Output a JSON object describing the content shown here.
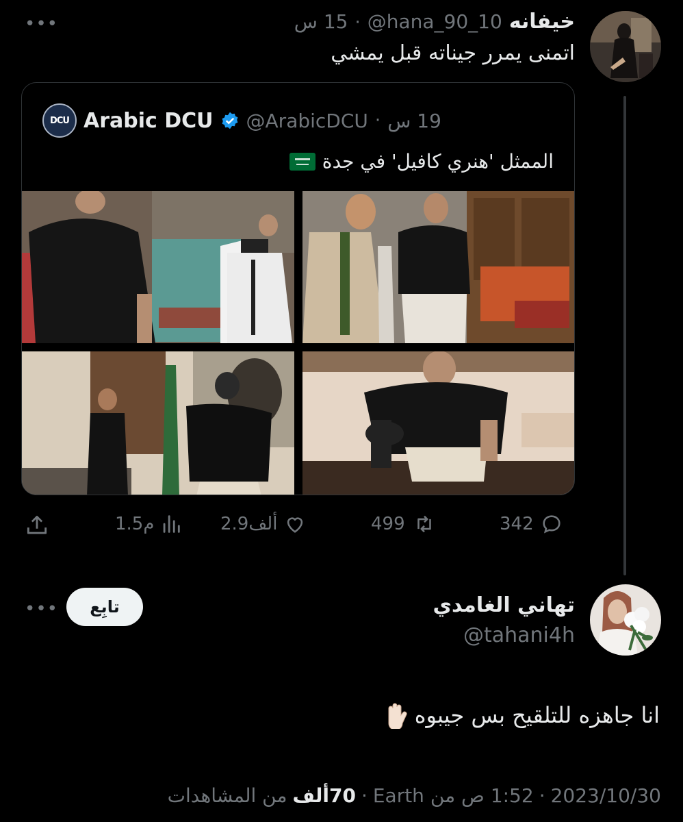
{
  "tweet1": {
    "display_name": "خيفانه",
    "handle": "@hana_90_10",
    "time": "15 س",
    "text": "اتمنى يمرر جيناته قبل يمشي"
  },
  "quote": {
    "display_name": "Arabic DCU",
    "handle": "@ArabicDCU",
    "time": "19 س",
    "logo_text": "DCU",
    "text": "الممثل 'هنري كافيل' في جدة"
  },
  "stats": {
    "replies": "342",
    "retweets": "499",
    "likes": "2.9ألف",
    "views": "1.5م"
  },
  "tweet2": {
    "display_name": "تهاني الغامدي",
    "handle": "@tahani4h",
    "follow_label": "تابِع",
    "text": "انا جاهزه للتلقيح بس جيبوه",
    "footer_date": "2023/10/30",
    "footer_time": "1:52 ص من Earth",
    "footer_views_count": "70ألف",
    "footer_views_label": "من المشاهدات"
  },
  "icons": {
    "more": "more-dots-icon",
    "verified": "verified-badge-icon",
    "reply": "reply-icon",
    "retweet": "retweet-icon",
    "like": "heart-icon",
    "views": "views-bar-chart-icon",
    "share": "share-icon",
    "flag": "saudi-flag-icon",
    "hand": "raised-hand-icon"
  },
  "colors": {
    "background": "#000000",
    "text": "#e7e9ea",
    "muted": "#71767b",
    "verified": "#1d9bf0",
    "flag_green": "#006c35"
  }
}
